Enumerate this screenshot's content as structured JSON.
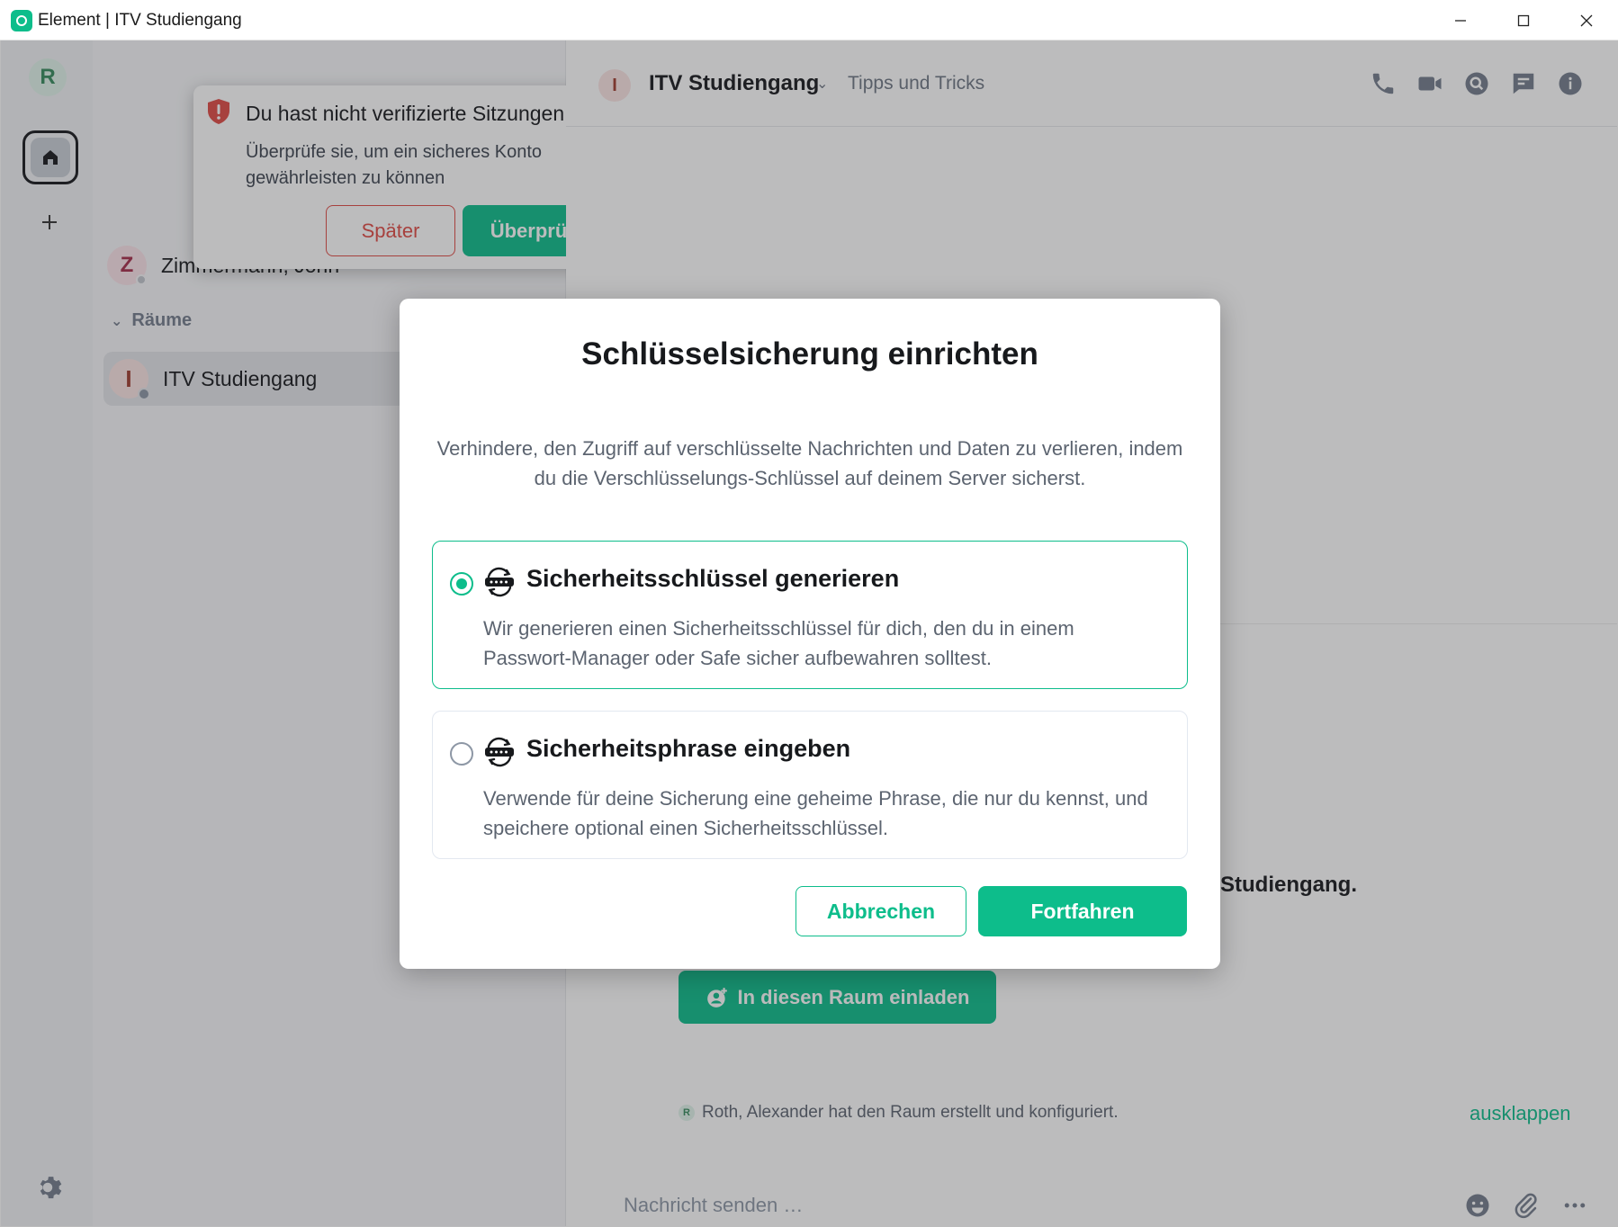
{
  "window": {
    "title": "Element | ITV Studiengang"
  },
  "spaces": {
    "user_initial": "R"
  },
  "roomlist": {
    "dm": {
      "initial": "Z",
      "name": "Zimmermann, John"
    },
    "section_title": "Räume",
    "rooms": [
      {
        "initial": "I",
        "name": "ITV Studiengang"
      }
    ]
  },
  "toast": {
    "title": "Du hast nicht verifizierte Sitzungen",
    "description": "Überprüfe sie, um ein sicheres Konto gewährleisten zu können",
    "later_label": "Später",
    "verify_label": "Überprüfen"
  },
  "room": {
    "avatar_initial": "I",
    "name": "ITV Studiengang",
    "topic": "Tipps und Tricks",
    "welcome_tail": "Studiengang.",
    "invite_label": "In diesen Raum einladen",
    "event_avatar": "R",
    "event_text": "Roth, Alexander hat den Raum erstellt und konfiguriert.",
    "expand_label": "ausklappen",
    "composer_placeholder": "Nachricht senden …"
  },
  "dialog": {
    "title": "Schlüsselsicherung einrichten",
    "description": "Verhindere, den Zugriff auf verschlüsselte Nachrichten und Daten zu verlieren, indem du die Verschlüsselungs-Schlüssel auf deinem Server sicherst.",
    "options": [
      {
        "title": "Sicherheitsschlüssel generieren",
        "description": "Wir generieren einen Sicherheitsschlüssel für dich, den du in einem Passwort-Manager oder Safe sicher aufbewahren solltest.",
        "selected": true
      },
      {
        "title": "Sicherheitsphrase eingeben",
        "description": "Verwende für deine Sicherung eine geheime Phrase, die nur du kennst, und speichere optional einen Sicherheitsschlüssel.",
        "selected": false
      }
    ],
    "cancel_label": "Abbrechen",
    "continue_label": "Fortfahren"
  },
  "colors": {
    "accent": "#0dbd8b",
    "danger": "#e04a45"
  }
}
